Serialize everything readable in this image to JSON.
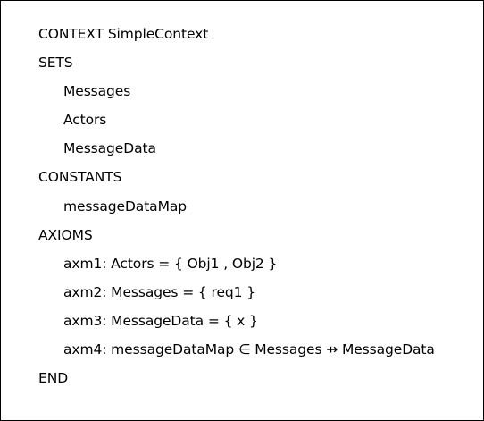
{
  "context": {
    "header": "CONTEXT SimpleContext",
    "sets_keyword": "SETS",
    "sets": [
      "Messages",
      "Actors",
      "MessageData"
    ],
    "constants_keyword": "CONSTANTS",
    "constants": [
      "messageDataMap"
    ],
    "axioms_keyword": "AXIOMS",
    "axioms": [
      "axm1: Actors = { Obj1 , Obj2 }",
      "axm2: Messages = { req1 }",
      "axm3: MessageData = { x }",
      "axm4: messageDataMap ∈ Messages ⇸ MessageData"
    ],
    "end_keyword": "END"
  }
}
